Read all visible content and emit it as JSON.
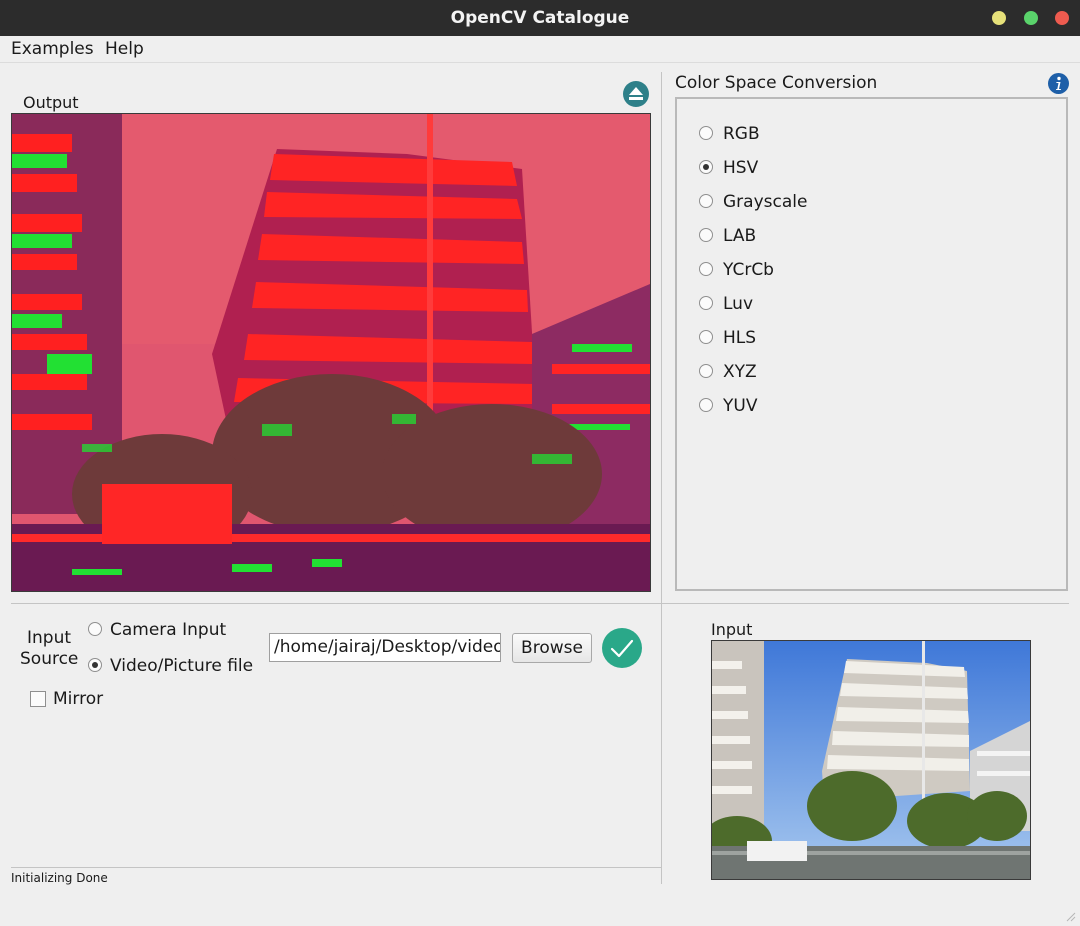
{
  "window": {
    "title": "OpenCV Catalogue",
    "controls": [
      "minimize",
      "maximize",
      "close"
    ],
    "colors": {
      "minimize": "#e6e17a",
      "maximize": "#5ad36b",
      "close": "#ee5b4f"
    }
  },
  "menubar": {
    "items": [
      "Examples",
      "Help"
    ]
  },
  "output": {
    "label": "Output",
    "eject_icon": "eject-icon"
  },
  "color_space": {
    "title": "Color Space Conversion",
    "info_icon": "info-icon",
    "options": [
      "RGB",
      "HSV",
      "Grayscale",
      "LAB",
      "YCrCb",
      "Luv",
      "HLS",
      "XYZ",
      "YUV"
    ],
    "selected": "HSV"
  },
  "input_source": {
    "label_line1": "Input",
    "label_line2": "Source",
    "camera_label": "Camera Input",
    "file_label": "Video/Picture file",
    "selected": "file",
    "path_value": "/home/jairaj/Desktop/video",
    "browse_label": "Browse",
    "confirm_icon": "check-icon",
    "mirror_label": "Mirror",
    "mirror_checked": false
  },
  "input": {
    "label": "Input"
  },
  "status": {
    "text": "Initializing Done"
  },
  "colors": {
    "accent_teal": "#2aa889",
    "info_blue": "#1e5fa8",
    "eject_teal": "#2e8089"
  }
}
